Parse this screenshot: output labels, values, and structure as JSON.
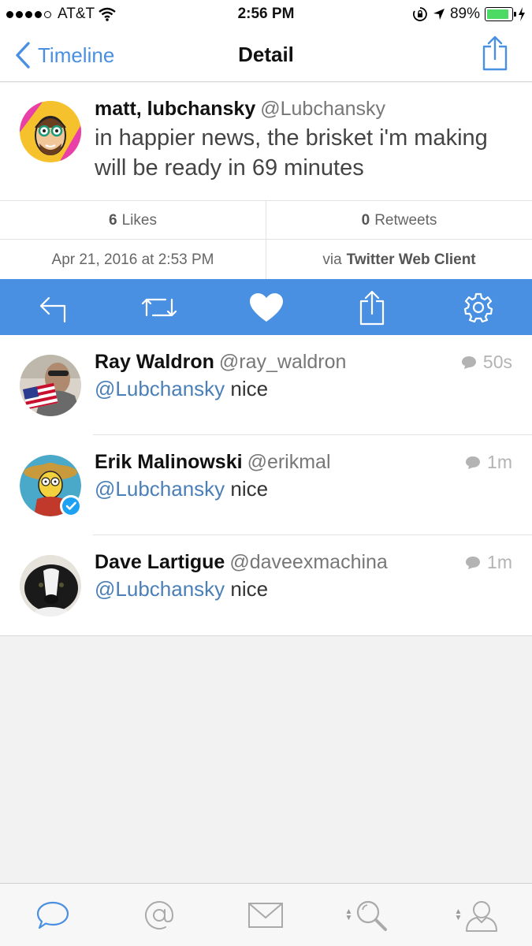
{
  "status_bar": {
    "carrier": "AT&T",
    "time": "2:56 PM",
    "battery": "89%"
  },
  "nav": {
    "back_label": "Timeline",
    "title": "Detail"
  },
  "tweet": {
    "author_name": "matt, lubchansky",
    "author_handle": "@Lubchansky",
    "text": "in happier news, the brisket i'm making will be ready in 69 minutes"
  },
  "stats": {
    "likes_count": "6",
    "likes_label": "Likes",
    "retweets_count": "0",
    "retweets_label": "Retweets",
    "date": "Apr 21, 2016 at 2:53 PM",
    "via_label": "via",
    "client": "Twitter Web Client"
  },
  "actions": [
    "reply-icon",
    "retweet-icon",
    "like-icon",
    "share-icon",
    "settings-icon"
  ],
  "replies": [
    {
      "name": "Ray Waldron",
      "handle": "@ray_waldron",
      "mention": "@Lubchansky",
      "text": "nice",
      "time": "50s"
    },
    {
      "name": "Erik Malinowski",
      "handle": "@erikmal",
      "mention": "@Lubchansky",
      "text": "nice",
      "time": "1m"
    },
    {
      "name": "Dave Lartigue",
      "handle": "@daveexmachina",
      "mention": "@Lubchansky",
      "text": "nice",
      "time": "1m"
    }
  ],
  "tabs": [
    "timeline-tab-icon",
    "mentions-tab-icon",
    "messages-tab-icon",
    "search-tab-icon",
    "profile-tab-icon"
  ],
  "colors": {
    "accent": "#4a90e2",
    "mention": "#4a7fb8",
    "battery": "#4cd964"
  }
}
